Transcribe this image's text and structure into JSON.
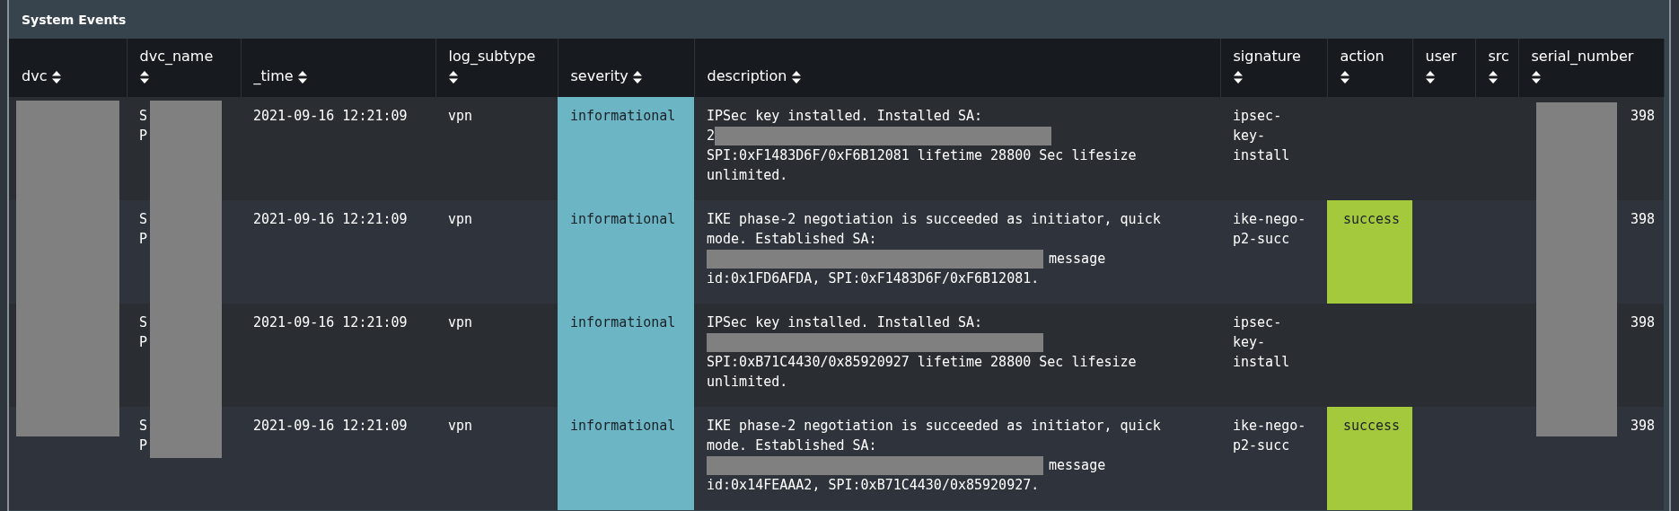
{
  "panel": {
    "title": "System Events"
  },
  "table": {
    "columns": [
      {
        "label": "dvc",
        "sortable": true
      },
      {
        "label": "dvc_name",
        "sortable": true
      },
      {
        "label": "_time",
        "sortable": true
      },
      {
        "label": "log_subtype",
        "sortable": true
      },
      {
        "label": "severity",
        "sortable": true
      },
      {
        "label": "description",
        "sortable": true
      },
      {
        "label": "signature",
        "sortable": true
      },
      {
        "label": "action",
        "sortable": true
      },
      {
        "label": "user",
        "sortable": true
      },
      {
        "label": "src",
        "sortable": true
      },
      {
        "label": "serial_number",
        "sortable": true
      }
    ],
    "rows": [
      {
        "dvc": {
          "redacted": true
        },
        "dvc_name": {
          "lines": [
            "S",
            "P"
          ],
          "redacted": true
        },
        "time": "2021-09-16 12:21:09",
        "log_subtype": "vpn",
        "severity": {
          "text": "informational",
          "color": "#6cb5c4"
        },
        "description": [
          [
            {
              "text": "IPSec key installed. Installed SA:"
            }
          ],
          [
            {
              "text": "2"
            },
            {
              "kind": "redacted"
            }
          ],
          [
            {
              "text": "SPI:0xF1483D6F/0xF6B12081 lifetime 28800 Sec lifesize"
            }
          ],
          [
            {
              "text": "unlimited."
            }
          ]
        ],
        "signature": [
          "ipsec-",
          "key-",
          "install"
        ],
        "serial_number": {
          "text": "398",
          "redacted": true
        }
      },
      {
        "dvc": {
          "redacted": false
        },
        "dvc_name": {
          "lines": [
            "S",
            "P"
          ],
          "redacted": false
        },
        "time": "2021-09-16 12:21:09",
        "log_subtype": "vpn",
        "severity": {
          "text": "informational",
          "color": "#6cb5c4"
        },
        "description": [
          [
            {
              "text": "IKE phase-2 negotiation is succeeded as initiator, quick"
            }
          ],
          [
            {
              "text": "mode. Established SA:"
            }
          ],
          [
            {
              "kind": "redacted"
            },
            {
              "text": "message"
            }
          ],
          [
            {
              "text": "id:0x1FD6AFDA, SPI:0xF1483D6F/0xF6B12081."
            }
          ]
        ],
        "signature": [
          "ike-nego-",
          "p2-succ"
        ],
        "action": {
          "text": "success",
          "color": "#a4c93c"
        },
        "serial_number": {
          "text": "398",
          "redacted": false
        }
      },
      {
        "dvc": {
          "redacted": false
        },
        "dvc_name": {
          "lines": [
            "S",
            "P"
          ],
          "redacted": false
        },
        "time": "2021-09-16 12:21:09",
        "log_subtype": "vpn",
        "severity": {
          "text": "informational",
          "color": "#6cb5c4"
        },
        "description": [
          [
            {
              "text": "IPSec key installed. Installed SA:"
            }
          ],
          [
            {
              "kind": "redacted"
            }
          ],
          [
            {
              "text": "SPI:0xB71C4430/0x85920927 lifetime 28800 Sec lifesize"
            }
          ],
          [
            {
              "text": "unlimited."
            }
          ]
        ],
        "signature": [
          "ipsec-",
          "key-",
          "install"
        ],
        "serial_number": {
          "text": "398",
          "redacted": false
        }
      },
      {
        "dvc": {
          "redacted": false
        },
        "dvc_name": {
          "lines": [
            "S",
            "P"
          ],
          "redacted": false
        },
        "time": "2021-09-16 12:21:09",
        "log_subtype": "vpn",
        "severity": {
          "text": "informational",
          "color": "#6cb5c4"
        },
        "description": [
          [
            {
              "text": "IKE phase-2 negotiation is succeeded as initiator, quick"
            }
          ],
          [
            {
              "text": "mode. Established SA:"
            }
          ],
          [
            {
              "kind": "redacted"
            },
            {
              "text": "message"
            }
          ],
          [
            {
              "text": "id:0x14FEAAA2, SPI:0xB71C4430/0x85920927."
            }
          ]
        ],
        "signature": [
          "ike-nego-",
          "p2-succ"
        ],
        "action": {
          "text": "success",
          "color": "#a4c93c"
        },
        "serial_number": {
          "text": "398",
          "redacted": false
        }
      }
    ]
  }
}
